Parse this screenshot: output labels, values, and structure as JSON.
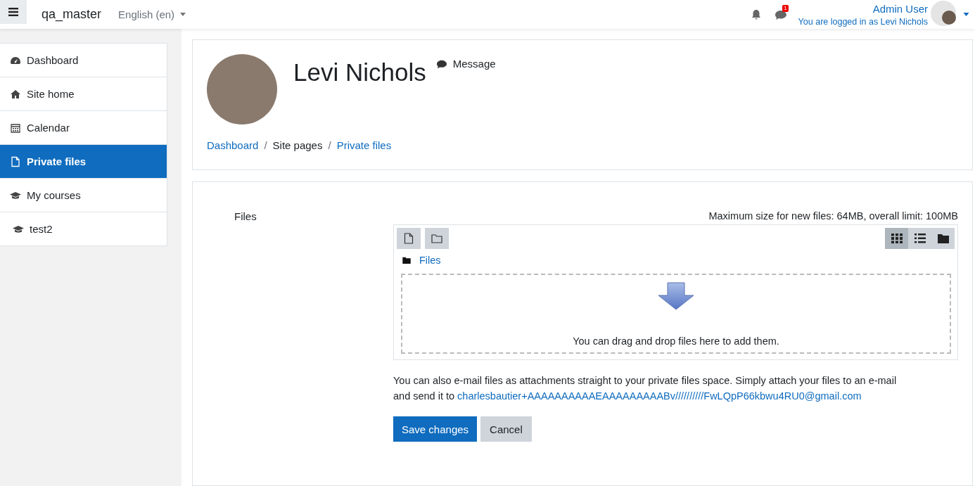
{
  "navbar": {
    "site_name": "qa_master",
    "language": "English (en)",
    "notification_count": "1",
    "user_name": "Admin User",
    "login_note": "You are logged in as Levi Nichols"
  },
  "sidebar": {
    "items": [
      {
        "label": "Dashboard",
        "selected": false
      },
      {
        "label": "Site home",
        "selected": false
      },
      {
        "label": "Calendar",
        "selected": false
      },
      {
        "label": "Private files",
        "selected": true
      },
      {
        "label": "My courses",
        "selected": false
      },
      {
        "label": "test2",
        "selected": false
      }
    ]
  },
  "header": {
    "name": "Levi Nichols",
    "message": "Message",
    "separators": [
      "/",
      "/"
    ],
    "breadcrumb": [
      {
        "label": "Dashboard",
        "link": true
      },
      {
        "label": "Site pages",
        "link": false
      },
      {
        "label": "Private files",
        "link": true
      }
    ]
  },
  "form": {
    "label": "Files",
    "limits": "Maximum size for new files: 64MB, overall limit: 100MB",
    "views": [
      {
        "selected": true
      },
      {
        "selected": false
      },
      {
        "selected": false
      }
    ],
    "path": "Files",
    "drop_hint": "You can drag and drop files here to add them.",
    "email_note": "You can also e-mail files as attachments straight to your private files space. Simply attach your files to an e-mail and send it to",
    "email": "charlesbautier+AAAAAAAAAAEAAAAAAAAABv//////////FwLQpP66kbwu4RU0@gmail.com",
    "buttons": [
      "Save changes",
      "Cancel"
    ]
  }
}
